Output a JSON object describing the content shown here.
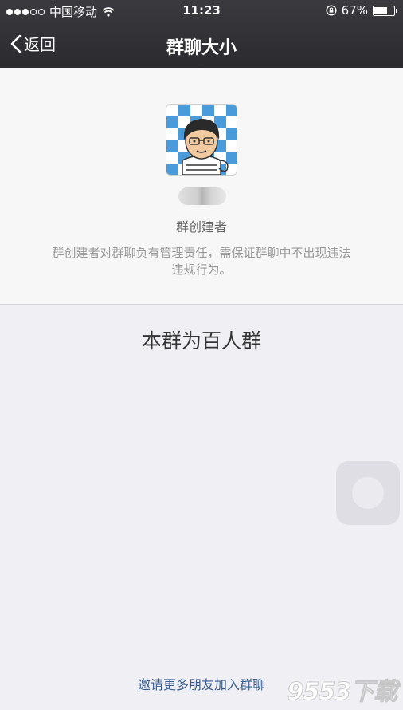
{
  "status_bar": {
    "carrier": "中国移动",
    "time": "11:23",
    "battery_percent": "67%",
    "battery_level": 0.67,
    "signal_filled": 3,
    "signal_total": 5
  },
  "nav": {
    "back_label": "返回",
    "title": "群聊大小"
  },
  "creator": {
    "role_label": "群创建者",
    "description": "群创建者对群聊负有管理责任，需保证群聊中不出现违法违规行为。"
  },
  "group": {
    "size_text": "本群为百人群"
  },
  "footer": {
    "invite_label": "邀请更多朋友加入群聊"
  },
  "watermark": {
    "text": "9553下载"
  },
  "colors": {
    "navbar": "#2b2b2f",
    "link": "#3a5b8c",
    "avatar_pattern": "#4a9bd9"
  }
}
